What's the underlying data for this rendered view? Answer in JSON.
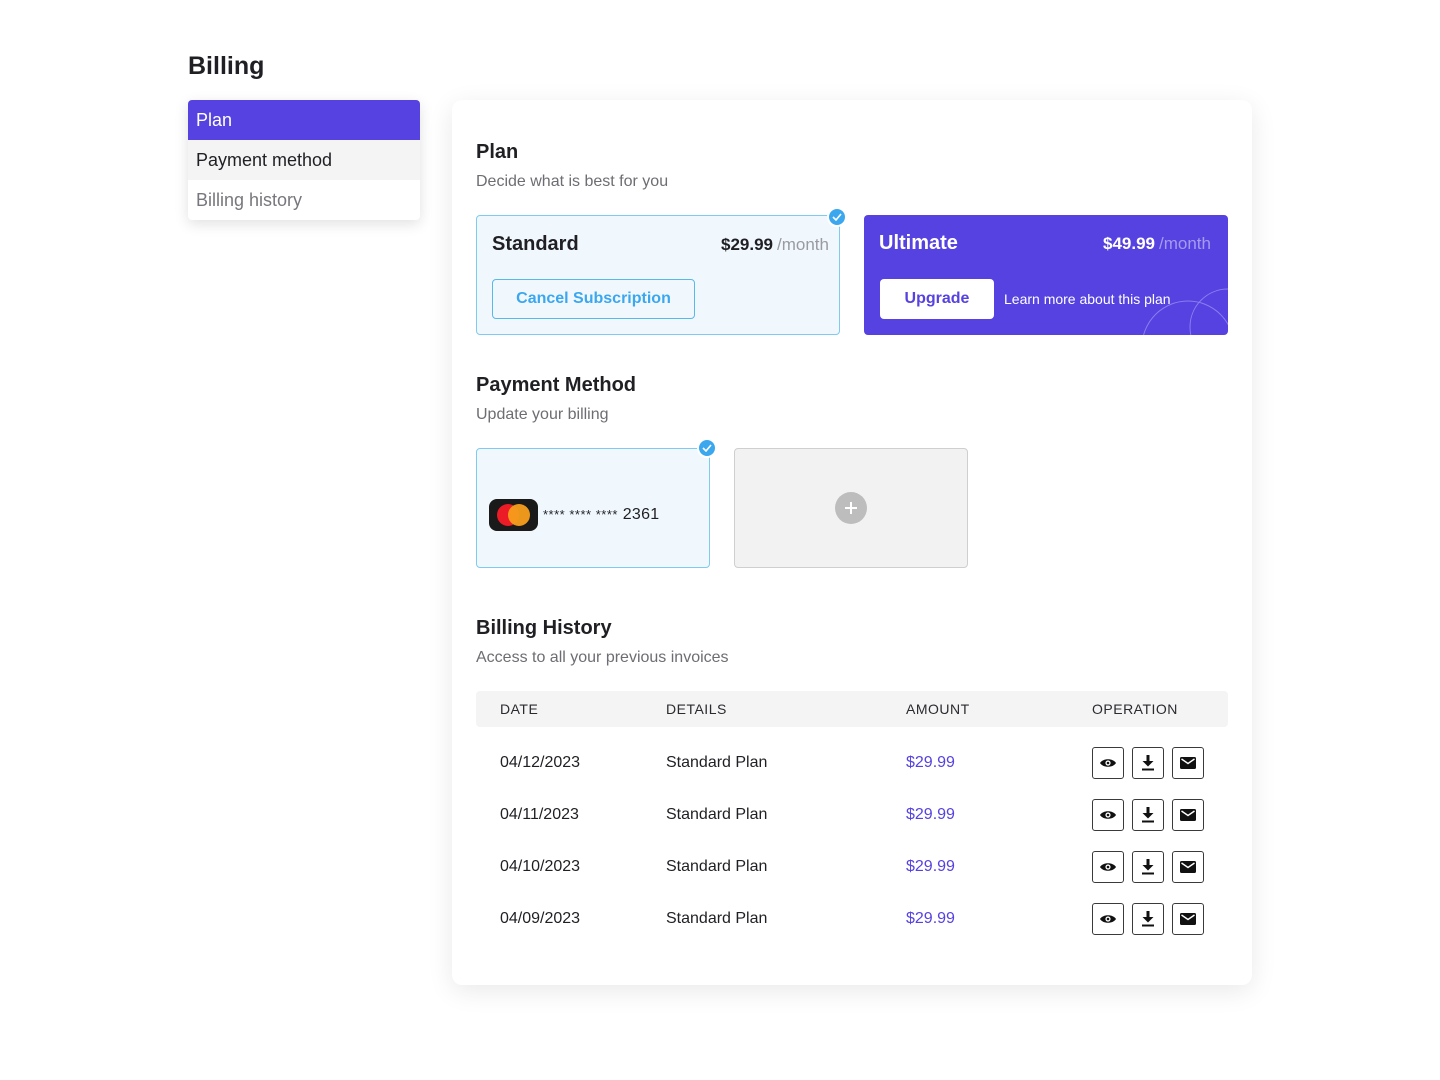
{
  "page": {
    "title": "Billing"
  },
  "sidebar": {
    "items": [
      {
        "label": "Plan"
      },
      {
        "label": "Payment method"
      },
      {
        "label": "Billing history"
      }
    ]
  },
  "plan_section": {
    "title": "Plan",
    "subtitle": "Decide what is best for you",
    "standard": {
      "name": "Standard",
      "price": "$29.99",
      "period": "/month",
      "button": "Cancel Subscription"
    },
    "ultimate": {
      "name": "Ultimate",
      "price": "$49.99",
      "period": "/month",
      "button": "Upgrade",
      "link": "Learn more about this plan"
    }
  },
  "payment_section": {
    "title": "Payment Method",
    "subtitle": "Update your billing",
    "card": {
      "mask": "**** **** ****",
      "last4": "2361",
      "brand_icon": "mastercard-icon"
    },
    "add_icon": "plus-icon"
  },
  "history_section": {
    "title": "Billing History",
    "subtitle": "Access to all your previous invoices",
    "columns": {
      "date": "DATE",
      "details": "DETAILS",
      "amount": "AMOUNT",
      "operation": "OPERATION"
    },
    "rows": [
      {
        "date": "04/12/2023",
        "details": "Standard Plan",
        "amount": "$29.99"
      },
      {
        "date": "04/11/2023",
        "details": "Standard Plan",
        "amount": "$29.99"
      },
      {
        "date": "04/10/2023",
        "details": "Standard Plan",
        "amount": "$29.99"
      },
      {
        "date": "04/09/2023",
        "details": "Standard Plan",
        "amount": "$29.99"
      }
    ],
    "operation_icons": [
      "eye-icon",
      "download-icon",
      "mail-icon"
    ]
  },
  "colors": {
    "accent": "#5542e0",
    "info": "#3ba7ee",
    "card_bg": "#f1f8fd"
  }
}
